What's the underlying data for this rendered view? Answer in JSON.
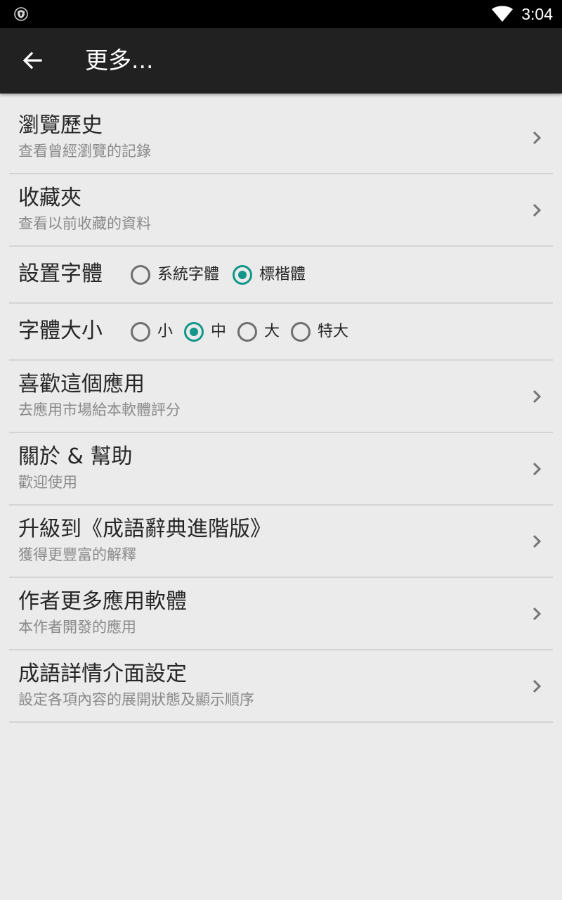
{
  "status_bar": {
    "time": "3:04",
    "icons": [
      "shield-icon",
      "wifi-icon"
    ]
  },
  "app_bar": {
    "title": "更多...",
    "back_icon": "arrow-left-icon"
  },
  "menu": {
    "history": {
      "title": "瀏覽歷史",
      "subtitle": "查看曾經瀏覽的記錄"
    },
    "favorites": {
      "title": "收藏夾",
      "subtitle": "查看以前收藏的資料"
    },
    "font": {
      "label": "設置字體",
      "options": [
        {
          "label": "系統字體",
          "selected": false
        },
        {
          "label": "標楷體",
          "selected": true
        }
      ]
    },
    "font_size": {
      "label": "字體大小",
      "options": [
        {
          "label": "小",
          "selected": false
        },
        {
          "label": "中",
          "selected": true
        },
        {
          "label": "大",
          "selected": false
        },
        {
          "label": "特大",
          "selected": false
        }
      ]
    },
    "like_app": {
      "title": "喜歡這個應用",
      "subtitle": "去應用市場給本軟體評分"
    },
    "about": {
      "title": "關於 & 幫助",
      "subtitle": "歡迎使用"
    },
    "upgrade": {
      "title": "升級到《成語辭典進階版》",
      "subtitle": "獲得更豐富的解釋"
    },
    "more_apps": {
      "title": "作者更多應用軟體",
      "subtitle": "本作者開發的應用"
    },
    "detail_settings": {
      "title": "成語詳情介面設定",
      "subtitle": "設定各項內容的展開狀態及顯示順序"
    }
  },
  "colors": {
    "accent": "#12968a",
    "app_bar": "#212121",
    "background": "#ebebeb"
  }
}
